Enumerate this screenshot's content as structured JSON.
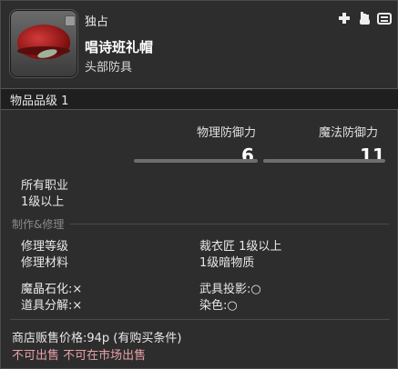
{
  "item": {
    "unique_tag": "独占",
    "name": "唱诗班礼帽",
    "category": "头部防具",
    "item_level": "物品品级 1"
  },
  "icons": [
    "plus-icon",
    "hand-icon",
    "gearset-icon"
  ],
  "stats": {
    "physical_label": "物理防御力",
    "physical_value": "6",
    "magic_label": "魔法防御力",
    "magic_value": "11"
  },
  "requirements": {
    "classes": "所有职业",
    "level": "1级以上"
  },
  "crafting": {
    "header": "制作&修理",
    "repair_level_label": "修理等级",
    "repair_level_value": "裁衣匠 1级以上",
    "repair_material_label": "修理材料",
    "repair_material_value": "1级暗物质",
    "materia_label": "魔晶石化:×",
    "projection_label": "武具投影:○",
    "desynth_label": "道具分解:×",
    "dye_label": "染色:○"
  },
  "shop": {
    "sell_price": "商店贩售价格:94p (有购买条件)",
    "restriction": "不可出售 不可在市场出售"
  }
}
